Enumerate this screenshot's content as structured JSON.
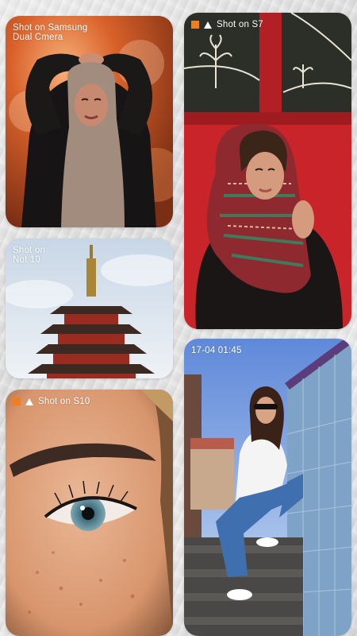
{
  "colors": {
    "orange_square": "#f07d1e",
    "white_triangle": "#ffffff",
    "wall_red": "#c9242a"
  },
  "cards": {
    "hijab_card": {
      "caption_line1": "Shot on Samsung",
      "caption_line2": "Dual Cmera"
    },
    "scarf_card": {
      "caption": "Shot on S7",
      "icons": [
        "orange-square-icon",
        "triangle-icon"
      ]
    },
    "pagoda_card": {
      "caption_line1": "Shot on",
      "caption_line2": "Not 10"
    },
    "street_card": {
      "caption": "17-04  01:45"
    },
    "eye_card": {
      "caption": "Shot on S10",
      "icons": [
        "orange-square-icon",
        "triangle-icon"
      ]
    }
  }
}
